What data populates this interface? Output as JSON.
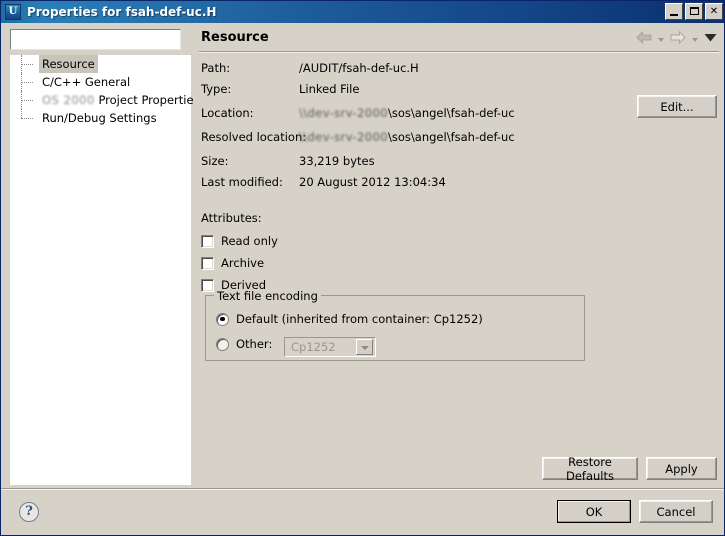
{
  "window": {
    "title": "Properties for fsah-def-uc.H",
    "icon": "app-icon-u",
    "icon_glyph": "U",
    "controls": {
      "minimize": "minimize-icon",
      "maximize": "maximize-icon",
      "close": "✕"
    }
  },
  "sidebar": {
    "filter": {
      "value": "",
      "placeholder": ""
    },
    "items": [
      {
        "label": "Resource",
        "selected": true
      },
      {
        "label": "C/C++ General",
        "selected": false
      },
      {
        "label": "Project Properties",
        "prefix_obscured": "OS 2000",
        "selected": false
      },
      {
        "label": "Run/Debug Settings",
        "selected": false
      }
    ]
  },
  "page": {
    "title": "Resource",
    "nav": {
      "back": "back-arrow-icon",
      "back_menu": "chevron-down-icon",
      "forward": "forward-arrow-icon",
      "forward_menu": "chevron-down-icon",
      "menu": "chevron-down-icon"
    },
    "properties": [
      {
        "label": "Path:",
        "value": "/AUDIT/fsah-def-uc.H",
        "obscured": ""
      },
      {
        "label": "Type:",
        "value": "Linked File",
        "obscured": ""
      },
      {
        "label": "Location:",
        "value": "\\sos\\angel\\fsah-def-uc",
        "obscured": "\\\\dev-srv-2000"
      },
      {
        "label": "Resolved location:",
        "value": "\\sos\\angel\\fsah-def-uc",
        "obscured": "\\\\dev-srv-2000"
      },
      {
        "label": "Size:",
        "value": "33,219  bytes",
        "obscured": ""
      },
      {
        "label": "Last modified:",
        "value": "20 August 2012 13:04:34",
        "obscured": ""
      }
    ],
    "edit_button": "Edit...",
    "attributes": {
      "title": "Attributes:",
      "checkboxes": [
        {
          "label": "Read only",
          "checked": false
        },
        {
          "label": "Archive",
          "checked": false
        },
        {
          "label": "Derived",
          "checked": false
        }
      ]
    },
    "encoding": {
      "legend": "Text file encoding",
      "default_option": "Default (inherited from container: Cp1252)",
      "default_selected": true,
      "other_option": "Other:",
      "other_selected": false,
      "other_value": "Cp1252",
      "other_enabled": false
    },
    "restore_defaults_button": "Restore Defaults",
    "apply_button": "Apply"
  },
  "footer": {
    "help_icon": "help-icon",
    "help_glyph": "?",
    "ok_button": "OK",
    "cancel_button": "Cancel"
  }
}
